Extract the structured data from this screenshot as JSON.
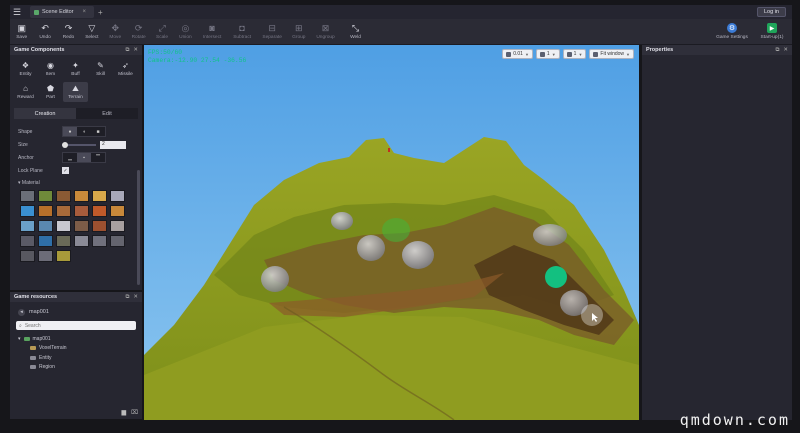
{
  "titlebar": {
    "tab_title": "Scene Editor",
    "add_tab": "+",
    "close": "×",
    "login_label": "Log in"
  },
  "toolbar": {
    "tools": [
      {
        "label": "Save",
        "icon": "save-icon",
        "glyph": "▣"
      },
      {
        "label": "Undo",
        "icon": "undo-icon",
        "glyph": "↶"
      },
      {
        "label": "Redo",
        "icon": "redo-icon",
        "glyph": "↷"
      },
      {
        "label": "Select",
        "icon": "select-icon",
        "glyph": "▽"
      },
      {
        "label": "Move",
        "icon": "move-icon",
        "glyph": "✥"
      },
      {
        "label": "Rotate",
        "icon": "rotate-icon",
        "glyph": "⟳"
      },
      {
        "label": "Scale",
        "icon": "scale-icon",
        "glyph": "⤢"
      },
      {
        "label": "Union",
        "icon": "union-icon",
        "glyph": "◎"
      },
      {
        "label": "Intersect",
        "icon": "intersect-icon",
        "glyph": "◙"
      },
      {
        "label": "Subtract",
        "icon": "subtract-icon",
        "glyph": "◘"
      },
      {
        "label": "Separate",
        "icon": "separate-icon",
        "glyph": "⊟"
      },
      {
        "label": "Group",
        "icon": "group-icon",
        "glyph": "⊞"
      },
      {
        "label": "Ungroup",
        "icon": "ungroup-icon",
        "glyph": "⊠"
      },
      {
        "label": "Weld",
        "icon": "weld-icon",
        "glyph": "⤡"
      }
    ],
    "game_settings_label": "Game Settings",
    "startup_label": "Start-up(1)"
  },
  "components_panel": {
    "title": "Game Components",
    "items": [
      {
        "label": "Entity",
        "icon": "entity-icon",
        "glyph": "❖"
      },
      {
        "label": "Item",
        "icon": "item-icon",
        "glyph": "◉"
      },
      {
        "label": "Buff",
        "icon": "buff-icon",
        "glyph": "✦"
      },
      {
        "label": "Skill",
        "icon": "skill-icon",
        "glyph": "✎"
      },
      {
        "label": "Missile",
        "icon": "missile-icon",
        "glyph": "➶"
      },
      {
        "label": "Reward",
        "icon": "reward-icon",
        "glyph": "⌂"
      },
      {
        "label": "Part",
        "icon": "part-icon",
        "glyph": "⬟"
      },
      {
        "label": "Terrain",
        "icon": "terrain-icon",
        "glyph": "⛰"
      }
    ],
    "tab_creation": "Creation",
    "tab_edit": "Edit",
    "shape_label": "Shape",
    "size_label": "Size",
    "size_value": "2",
    "anchor_label": "Anchor",
    "lock_plane_label": "Lock Plane",
    "material_label": "Material",
    "material_swatches": [
      "#6b6f78",
      "#6f8a3a",
      "#8a5a34",
      "#c98a3a",
      "#d8a84a",
      "#a8a8b8",
      "#3a8fd0",
      "#b8702a",
      "#a86a3a",
      "#a85c3c",
      "#c05a2a",
      "#c8883a",
      "#6aa0c8",
      "#5a88b0",
      "#c8c8d0",
      "#7c5c48",
      "#9c5030",
      "#a8a0a0",
      "#5a5a66",
      "#2f6fa8",
      "#6a6a58",
      "#8a8a96",
      "#70707c",
      "#64646e",
      "#585860",
      "#6c6c78",
      "#a89a3a"
    ]
  },
  "resources_panel": {
    "title": "Game resources",
    "crumb": "map001",
    "search_placeholder": "Search",
    "tree": [
      {
        "label": "map001",
        "level": 0
      },
      {
        "label": "VoxelTerrain",
        "level": 1
      },
      {
        "label": "Entity",
        "level": 1
      },
      {
        "label": "Region",
        "level": 1
      }
    ]
  },
  "viewport": {
    "fps": "FPS:50/60",
    "camera": "Camera:-12.90 27.54 -36.56",
    "controls": [
      "0.01",
      "1",
      "1",
      "Fit window"
    ]
  },
  "properties_panel": {
    "title": "Properties"
  },
  "watermark": "qmdown.com",
  "colors": {
    "accent_blue": "#3b7bd6",
    "accent_green": "#1fa55a",
    "hud_green": "#12c28a",
    "sky": "#5fa9e6",
    "grass": "#8a9a1e"
  }
}
